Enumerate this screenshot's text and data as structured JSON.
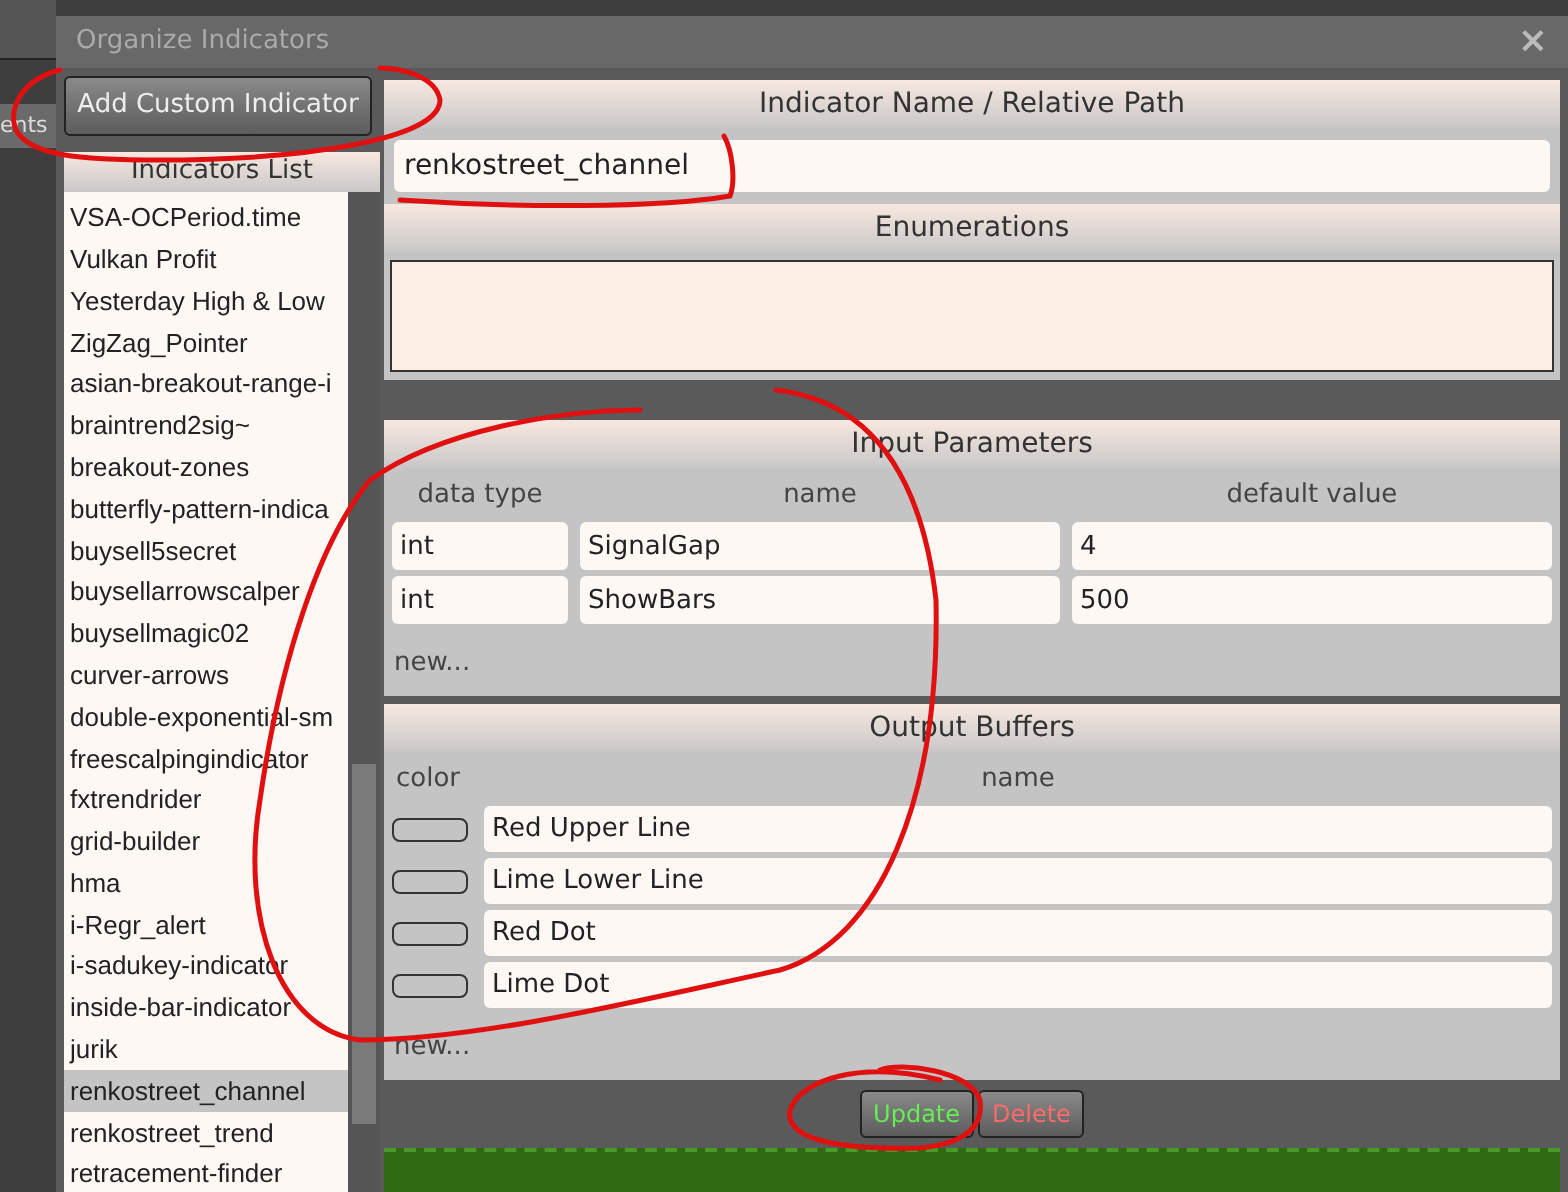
{
  "background_app": {
    "label": "ents"
  },
  "dialog": {
    "title": "Organize Indicators",
    "close": "×"
  },
  "add_button": "Add Custom Indicator",
  "indicators_list": {
    "title": "Indicators List",
    "items": [
      {
        "label": "VSA-OCPeriod.time",
        "selected": false
      },
      {
        "label": "Vulkan Profit",
        "selected": false
      },
      {
        "label": "Yesterday High & Low",
        "selected": false
      },
      {
        "label": "ZigZag_Pointer",
        "selected": false
      },
      {
        "label": "asian-breakout-range-i",
        "selected": false
      },
      {
        "label": "braintrend2sig~",
        "selected": false
      },
      {
        "label": "breakout-zones",
        "selected": false
      },
      {
        "label": "butterfly-pattern-indica",
        "selected": false
      },
      {
        "label": "buysell5secret",
        "selected": false
      },
      {
        "label": "buysellarrowscalper",
        "selected": false
      },
      {
        "label": "buysellmagic02",
        "selected": false
      },
      {
        "label": "curver-arrows",
        "selected": false
      },
      {
        "label": "double-exponential-sm",
        "selected": false
      },
      {
        "label": "freescalpingindicator",
        "selected": false
      },
      {
        "label": "fxtrendrider",
        "selected": false
      },
      {
        "label": "grid-builder",
        "selected": false
      },
      {
        "label": "hma",
        "selected": false
      },
      {
        "label": "i-Regr_alert",
        "selected": false
      },
      {
        "label": "i-sadukey-indicator",
        "selected": false
      },
      {
        "label": "inside-bar-indicator",
        "selected": false
      },
      {
        "label": "jurik",
        "selected": false
      },
      {
        "label": "renkostreet_channel",
        "selected": true
      },
      {
        "label": "renkostreet_trend",
        "selected": false
      },
      {
        "label": "retracement-finder",
        "selected": false
      }
    ]
  },
  "name_section": {
    "title": "Indicator Name / Relative Path",
    "value": "renkostreet_channel"
  },
  "enumerations": {
    "title": "Enumerations"
  },
  "input_parameters": {
    "title": "Input Parameters",
    "columns": [
      "data type",
      "name",
      "default value"
    ],
    "rows": [
      [
        "int",
        "SignalGap",
        "4"
      ],
      [
        "int",
        "ShowBars",
        "500"
      ]
    ],
    "new_link": "new..."
  },
  "output_buffers": {
    "title": "Output Buffers",
    "columns": [
      "color",
      "name"
    ],
    "rows": [
      {
        "name": "Red Upper Line"
      },
      {
        "name": "Lime Lower Line"
      },
      {
        "name": "Red Dot"
      },
      {
        "name": "Lime Dot"
      }
    ],
    "new_link": "new..."
  },
  "buttons": [
    {
      "label": "Update",
      "kind": "update"
    },
    {
      "label": "Delete",
      "kind": "delete"
    }
  ]
}
